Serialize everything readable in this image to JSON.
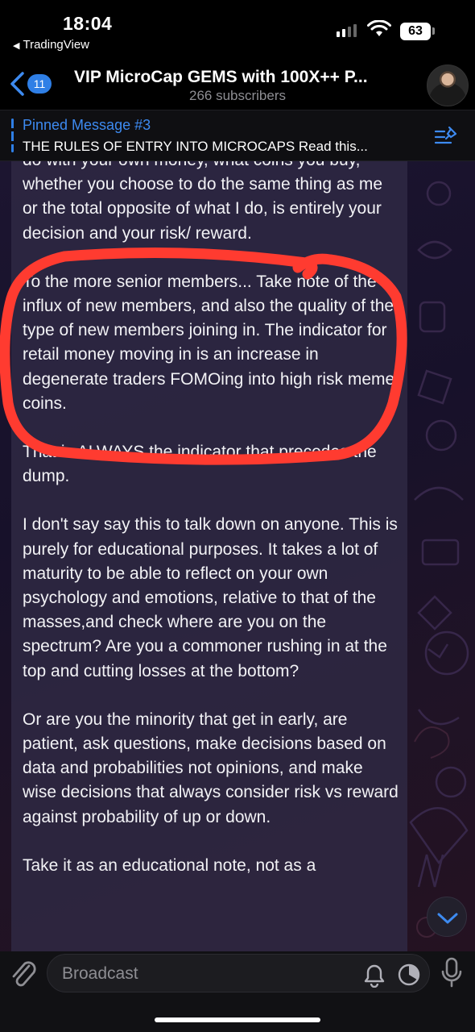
{
  "status_bar": {
    "time": "18:04",
    "back_app": "TradingView",
    "battery": "63"
  },
  "header": {
    "unread_count": "11",
    "title": "VIP MicroCap GEMS with 100X++ P...",
    "subtitle": "266 subscribers"
  },
  "pinned": {
    "title": "Pinned Message #3",
    "text": "THE RULES OF ENTRY INTO MICROCAPS Read this..."
  },
  "message": {
    "paragraphs": [
      "do with your own money, what coins you buy, whether you choose to do the same thing as me or the total opposite of what I do, is entirely your decision and your risk/ reward.",
      "To the more senior members... Take note of the influx of new members, and also the quality of the type of new members joining in. The indicator for retail money moving in is an increase in degenerate traders FOMOing into high risk meme coins.",
      "That is ALWAYS the indicator that precedes the dump.",
      "I don't say say this to talk down on anyone. This is purely for educational purposes. It takes a lot of maturity to be able to reflect on your own psychology and emotions, relative to that of the masses,and check where are you on the spectrum? Are you a commoner rushing in at the top and cutting losses at the bottom?",
      "Or are you the minority that get in early, are patient, ask questions, make decisions based on data and probabilities not opinions, and make wise decisions that always consider risk vs reward against probability of up or down.",
      "Take it as an educational note, not as a"
    ]
  },
  "input": {
    "placeholder": "Broadcast"
  },
  "colors": {
    "accent": "#2f7fe6",
    "highlight_stroke": "#ff3b30",
    "bubble": "#302a44"
  }
}
